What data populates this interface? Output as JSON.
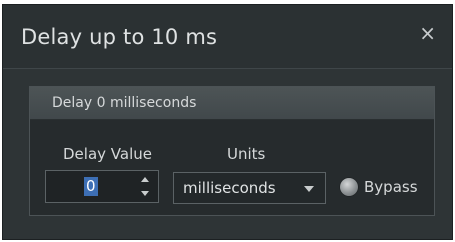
{
  "dialog": {
    "title": "Delay up to 10 ms",
    "close_glyph": "×"
  },
  "panel": {
    "title": "Delay 0 milliseconds",
    "delay_label": "Delay Value",
    "units_label": "Units",
    "delay_value": "0",
    "units_selected": "milliseconds",
    "bypass_label": "Bypass"
  },
  "icons": {
    "close": "close-icon",
    "spin_up": "chevron-up-icon",
    "spin_down": "chevron-down-icon",
    "dropdown": "caret-down-icon",
    "bypass": "radio-indicator-icon"
  },
  "colors": {
    "background": "#2e3436",
    "selection": "#3d6fb5"
  }
}
